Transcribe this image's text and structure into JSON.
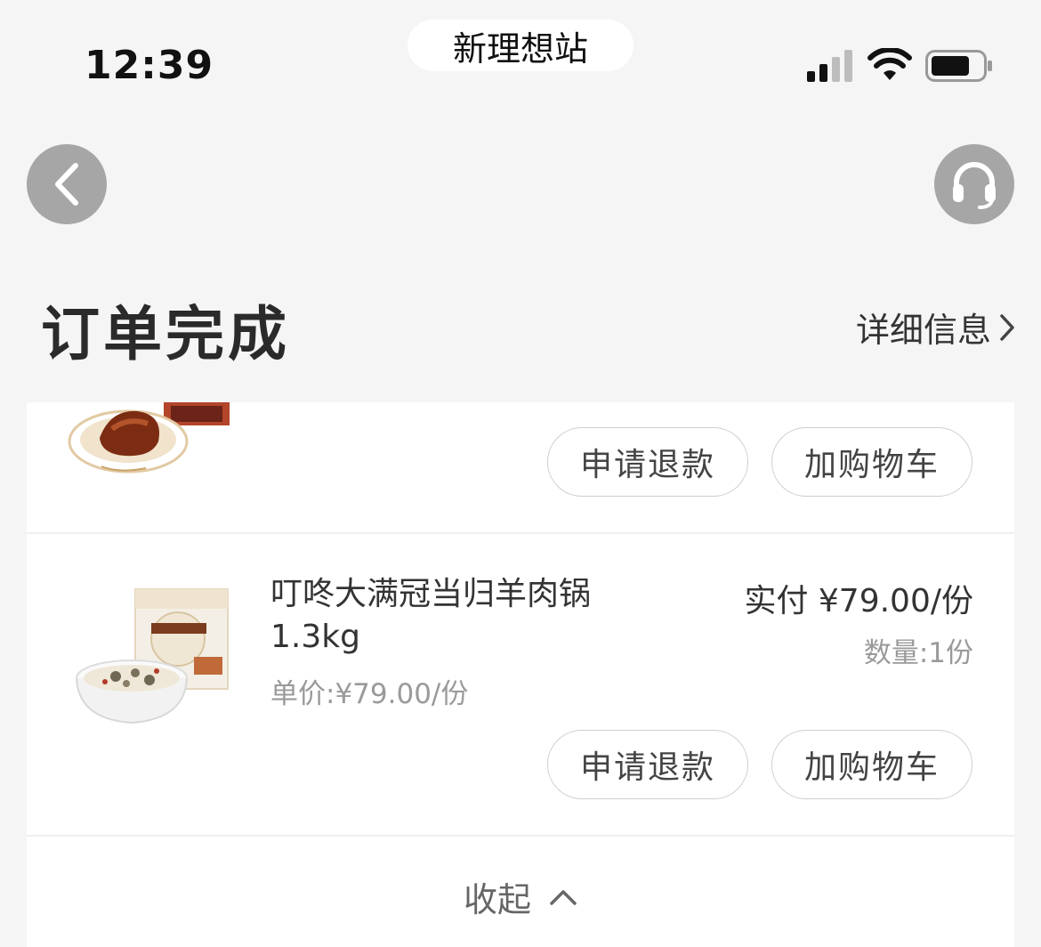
{
  "status_bar": {
    "time": "12:39",
    "island_text": "新理想站"
  },
  "nav": {
    "back_icon": "chevron-left-icon",
    "service_icon": "headset-icon"
  },
  "header": {
    "title": "订单完成",
    "detail_link": "详细信息"
  },
  "items": [
    {
      "refund_button": "申请退款",
      "add_cart_button": "加购物车"
    },
    {
      "name": "叮咚大满冠当归羊肉锅1.3kg",
      "paid_text": "实付 ¥79.00/份",
      "quantity_text": "数量:1份",
      "unit_price_text": "单价:¥79.00/份",
      "refund_button": "申请退款",
      "add_cart_button": "加购物车"
    }
  ],
  "footer": {
    "collapse_label": "收起"
  },
  "colors": {
    "background": "#f5f5f5",
    "card": "#ffffff",
    "nav_button": "#a6a6a6"
  }
}
